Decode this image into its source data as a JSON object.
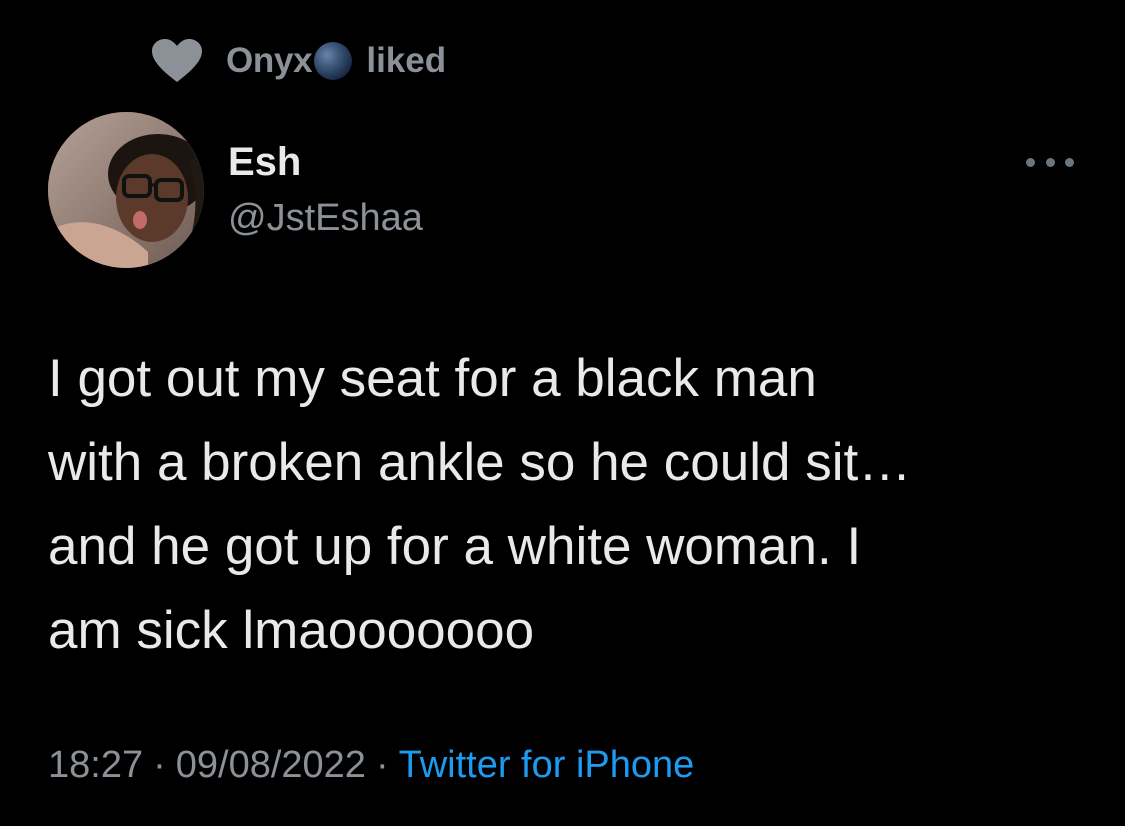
{
  "social_context": {
    "icon": "heart-icon",
    "name": "Onyx",
    "badge_icon": "globe-emoji-icon",
    "verb": "liked"
  },
  "author": {
    "display_name": "Esh",
    "handle": "@JstEshaa"
  },
  "more_icon": "more-icon",
  "tweet": {
    "lines": [
      "I got out my seat for a black man",
      "with a broken ankle so he could sit…",
      "and he got up for a white woman. I",
      "am sick lmaooooooo"
    ]
  },
  "meta": {
    "time": "18:27",
    "separator": "·",
    "date": "09/08/2022",
    "source": "Twitter for iPhone"
  },
  "colors": {
    "background": "#000000",
    "primary_text": "#e7e9ea",
    "secondary_text": "#8b9197",
    "link": "#1d9bf0"
  }
}
